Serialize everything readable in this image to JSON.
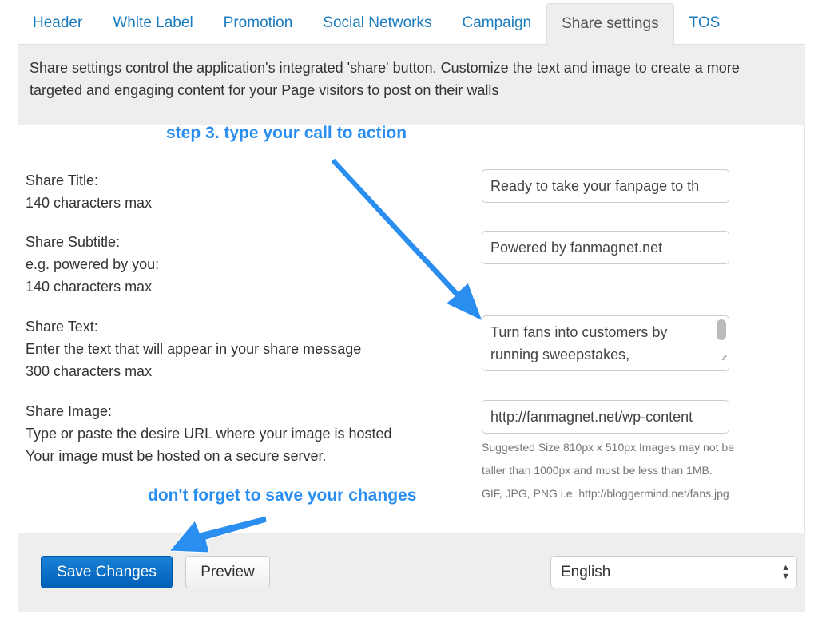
{
  "tabs": [
    {
      "label": "Header"
    },
    {
      "label": "White Label"
    },
    {
      "label": "Promotion"
    },
    {
      "label": "Social Networks"
    },
    {
      "label": "Campaign"
    },
    {
      "label": "Share settings",
      "active": true
    },
    {
      "label": "TOS"
    }
  ],
  "description": "Share settings control the application's integrated 'share' button. Customize the text and image to create a more targeted and engaging content for your Page visitors to post on their walls",
  "fields": {
    "title": {
      "label": "Share Title:",
      "hint": "140 characters max",
      "value": "Ready to take your fanpage to th"
    },
    "subtitle": {
      "label": "Share Subtitle:",
      "hint1": "e.g. powered by you:",
      "hint2": "140 characters max",
      "value": "Powered by fanmagnet.net"
    },
    "text": {
      "label": "Share Text:",
      "hint1": "Enter the text that will appear in your share message",
      "hint2": "300 characters max",
      "value": "Turn fans into customers by running sweepstakes,"
    },
    "image": {
      "label": "Share Image:",
      "hint1": "Type or paste the desire URL where your image is hosted",
      "hint2": "Your image must be hosted on a secure server.",
      "value": "http://fanmagnet.net/wp-content",
      "help1": "Suggested Size 810px x 510px Images may not be",
      "help2": "taller than 1000px and must be less than 1MB.",
      "help3": "GIF, JPG, PNG i.e. http://bloggermind.net/fans.jpg"
    }
  },
  "annotations": {
    "step3": "step 3. type your call to action",
    "save_note": "don't forget to save your changes",
    "color": "#2a8ef0"
  },
  "footer": {
    "save_label": "Save Changes",
    "preview_label": "Preview",
    "language": "English"
  }
}
